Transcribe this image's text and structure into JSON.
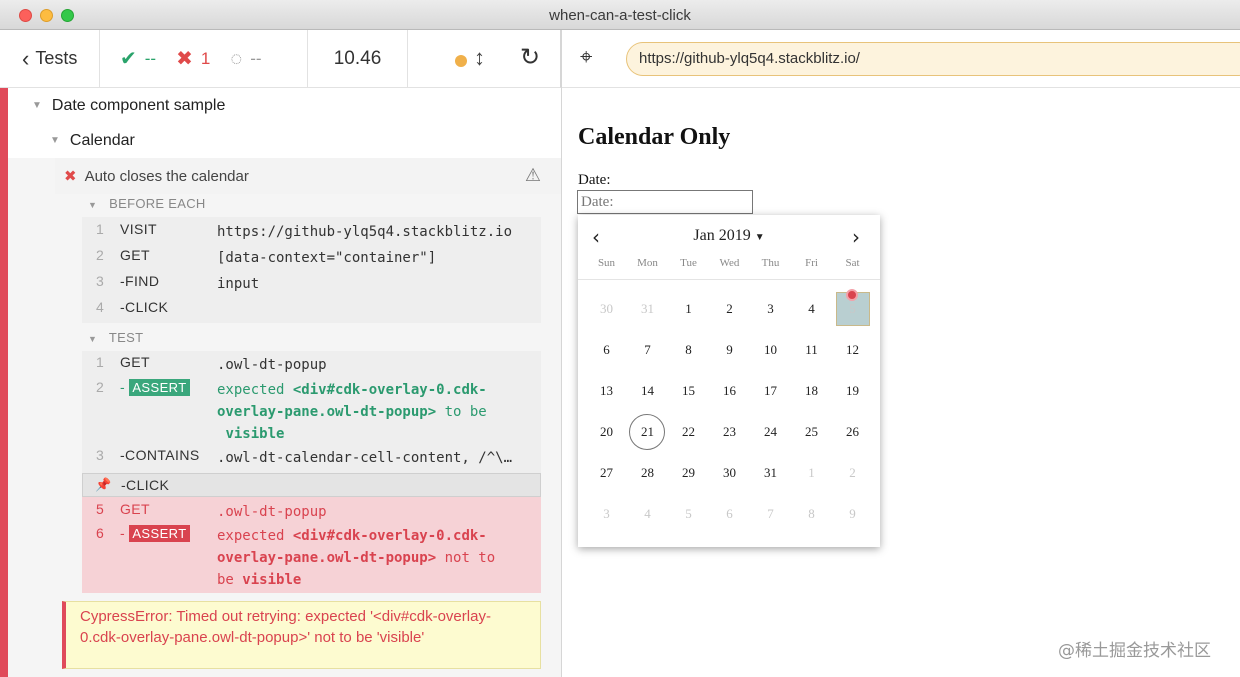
{
  "window": {
    "title": "when-can-a-test-click"
  },
  "reporter": {
    "tests_label": "Tests",
    "stats": {
      "passed": "--",
      "failed": "1",
      "pending": "--"
    },
    "duration": "10.46"
  },
  "aut": {
    "url": "https://github-ylq5q4.stackblitz.io/"
  },
  "suites": {
    "root": "Date component sample",
    "child": "Calendar"
  },
  "test": {
    "title": "Auto closes the calendar"
  },
  "before_each": {
    "label": "BEFORE EACH",
    "commands": [
      {
        "num": "1",
        "name": "VISIT",
        "msg": "https://github-ylq5q4.stackblitz.io"
      },
      {
        "num": "2",
        "name": "GET",
        "msg": "[data-context=\"container\"]"
      },
      {
        "num": "3",
        "name": "-FIND",
        "msg": "input"
      },
      {
        "num": "4",
        "name": "-CLICK",
        "msg": ""
      }
    ]
  },
  "test_body": {
    "label": "TEST",
    "commands": [
      {
        "num": "1",
        "name": "GET",
        "msg": ".owl-dt-popup"
      },
      {
        "num": "2",
        "name": "-",
        "badge": "ASSERT",
        "msg_pre": "expected",
        "msg_el": "<div#cdk-overlay-0.cdk-overlay-pane.owl-dt-popup>",
        "msg_post": "to be",
        "msg_last": "visible"
      },
      {
        "num": "3",
        "name": "-CONTAINS",
        "msg": ".owl-dt-calendar-cell-content, /^\\…"
      },
      {
        "num": "",
        "name": "-CLICK",
        "msg": ""
      },
      {
        "num": "5",
        "name": "GET",
        "msg": ".owl-dt-popup"
      },
      {
        "num": "6",
        "name": "-",
        "badge": "ASSERT",
        "msg_pre": "expected",
        "msg_el": "<div#cdk-overlay-0.cdk-overlay-pane.owl-dt-popup>",
        "msg_post": "not to",
        "msg_be": "be",
        "msg_last": "visible"
      }
    ]
  },
  "error": {
    "text": "CypressError: Timed out retrying: expected '<div#cdk-overlay-0.cdk-overlay-pane.owl-dt-popup>' not to be 'visible'"
  },
  "app": {
    "heading": "Calendar Only",
    "date_label": "Date:",
    "date_placeholder": "Date:",
    "calendar": {
      "period": "Jan 2019",
      "weekdays": [
        "Sun",
        "Mon",
        "Tue",
        "Wed",
        "Thu",
        "Fri",
        "Sat"
      ],
      "weeks": [
        [
          "30",
          "31",
          "1",
          "2",
          "3",
          "4",
          "5"
        ],
        [
          "6",
          "7",
          "8",
          "9",
          "10",
          "11",
          "12"
        ],
        [
          "13",
          "14",
          "15",
          "16",
          "17",
          "18",
          "19"
        ],
        [
          "20",
          "21",
          "22",
          "23",
          "24",
          "25",
          "26"
        ],
        [
          "27",
          "28",
          "29",
          "30",
          "31",
          "1",
          "2"
        ],
        [
          "3",
          "4",
          "5",
          "6",
          "7",
          "8",
          "9"
        ]
      ],
      "today": "21",
      "selected": "5"
    }
  },
  "watermark": "@稀土掘金技术社区",
  "icons": {
    "back": "chevron-left-icon",
    "pass": "check-icon",
    "fail": "x-icon",
    "pending": "spinner-icon",
    "reload": "reload-icon",
    "selector": "crosshair-icon",
    "warning": "warning-icon",
    "pin": "pin-icon"
  },
  "colors": {
    "pass": "#2aa36b",
    "fail": "#e04a4a",
    "url_bg": "#fdf3dd",
    "error_bg": "#fdfbd0"
  }
}
